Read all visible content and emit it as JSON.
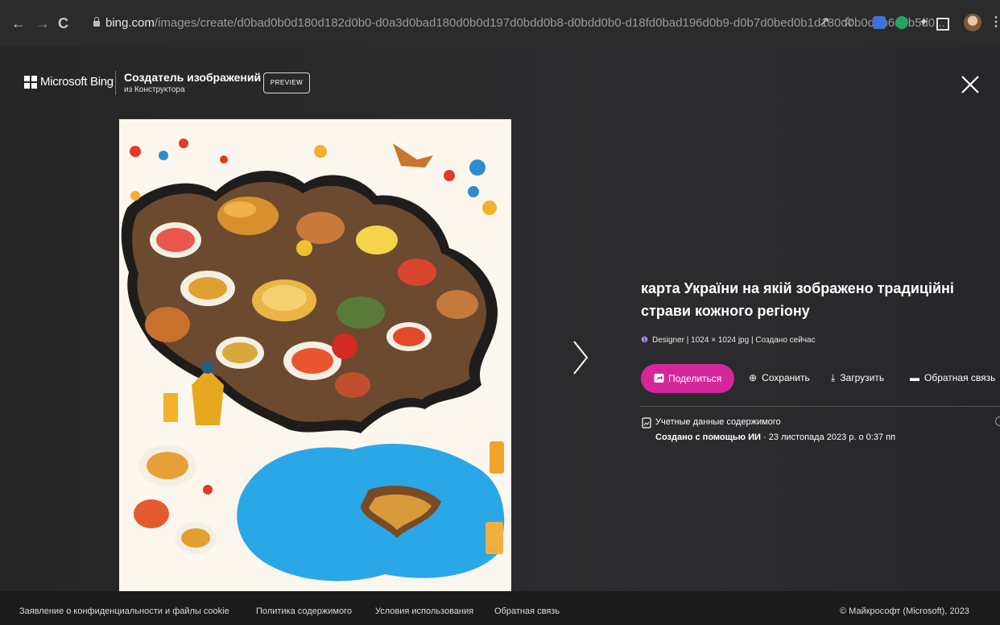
{
  "browser": {
    "url_host": "bing.com",
    "url_path": "/images/create/d0bad0b0d180d182d0b0-d0a3d0bad180d0b0d197d0bdd0b8-d0bdd0b0-d18fd0bad196d0b9-d0b7d0bed0b1d180d0b0d0b6d0b5d0..."
  },
  "header": {
    "brand": "Microsoft Bing",
    "app_title": "Создатель изображений",
    "app_subtitle": "из Конструктора",
    "preview_badge": "PREVIEW"
  },
  "details": {
    "title": "карта України на якій зображено традиційні страви кожного регіону",
    "source": "Designer",
    "dimensions": "1024 × 1024 jpg",
    "created": "Создано сейчас",
    "actions": {
      "share": "Поделиться",
      "save": "Сохранить",
      "download": "Загрузить",
      "feedback": "Обратная связь"
    },
    "credentials_label": "Учетные данные содержимого",
    "created_with": "Создано с помощью ИИ",
    "created_date": " · 23 листопада 2023 р. о 0:37 пп"
  },
  "footer": {
    "privacy": "Заявление о конфиденциальности и файлы cookie",
    "content_policy": "Политика содержимого",
    "terms": "Условия использования",
    "feedback": "Обратная связь",
    "copyright": "© Майкрософт (Microsoft), 2023"
  },
  "colors": {
    "accent": "#d5279b",
    "page_bg": "#282829",
    "footer_bg": "#1b1b1b"
  },
  "icons": [
    "back-icon",
    "forward-icon",
    "reload-icon",
    "lock-icon",
    "share-page-icon",
    "star-icon",
    "extensions-icon",
    "close-icon",
    "next-arrow-icon",
    "designer-icon",
    "share-icon",
    "save-icon",
    "download-icon",
    "feedback-icon",
    "credentials-icon",
    "info-icon"
  ]
}
